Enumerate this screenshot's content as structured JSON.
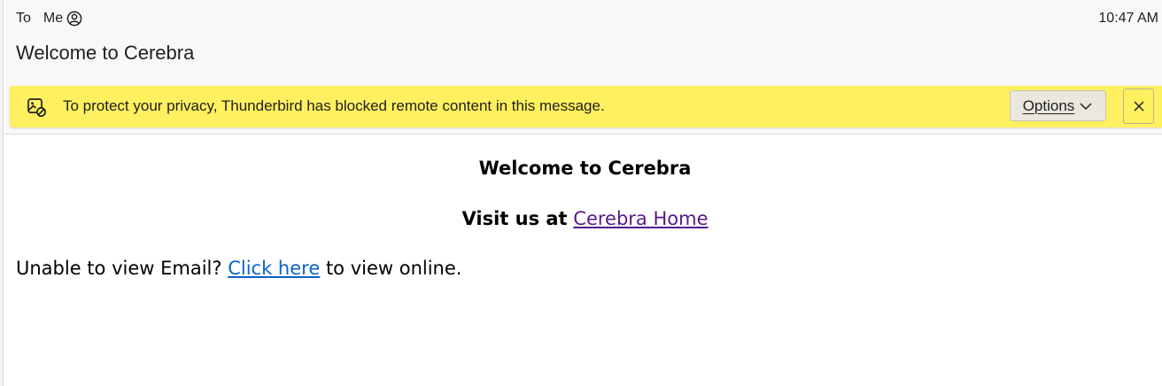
{
  "header": {
    "to_label": "To",
    "recipient": "Me",
    "time": "10:47 AM",
    "subject": "Welcome to Cerebra"
  },
  "notice": {
    "text": "To protect your privacy, Thunderbird has blocked remote content in this message.",
    "options_label": "Options",
    "background_color": "#fff060"
  },
  "email": {
    "title": "Welcome to Cerebra",
    "visit_prefix": "Visit us at",
    "visit_link": "Cerebra Home",
    "view_prefix": "Unable to view Email?",
    "view_link": "Click here",
    "view_suffix": "to view online."
  },
  "icons": {
    "recipient": "person-circle-icon",
    "notice": "blocked-image-icon",
    "options": "chevron-down-icon",
    "close": "close-icon"
  },
  "colors": {
    "visited_link": "#551a8b",
    "link": "#0b63c9"
  }
}
